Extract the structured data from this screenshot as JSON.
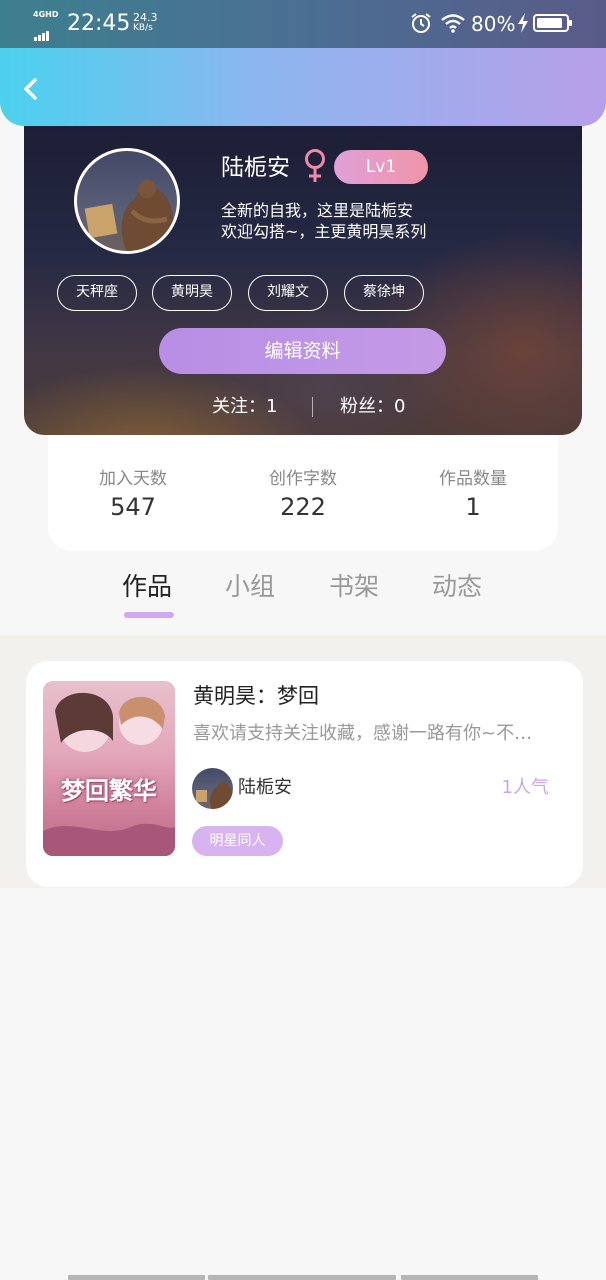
{
  "status_bar": {
    "network": "4GHD",
    "time": "22:45",
    "speed_value": "24.3",
    "speed_unit": "KB/s",
    "battery_percent": "80%",
    "icons": [
      "signal-icon",
      "alarm-icon",
      "wifi-icon",
      "charging-icon",
      "battery-icon"
    ]
  },
  "header": {
    "back_icon": "chevron-left-icon",
    "gradient": [
      "#4bd1ee",
      "#b79fe9"
    ]
  },
  "profile": {
    "username": "陆栀安",
    "gender_icon": "female-icon",
    "level": "Lv1",
    "bio_line1": "全新的自我，这里是陆栀安",
    "bio_line2": "欢迎勾搭~，主更黄明昊系列",
    "tags": [
      "天秤座",
      "黄明昊",
      "刘耀文",
      "蔡徐坤"
    ],
    "edit_button": "编辑资料",
    "following": "关注：1",
    "followers": "粉丝：0"
  },
  "stats": [
    {
      "label": "加入天数",
      "value": "547"
    },
    {
      "label": "创作字数",
      "value": "222"
    },
    {
      "label": "作品数量",
      "value": "1"
    }
  ],
  "tabs": [
    {
      "label": "作品",
      "active": true
    },
    {
      "label": "小组",
      "active": false
    },
    {
      "label": "书架",
      "active": false
    },
    {
      "label": "动态",
      "active": false
    }
  ],
  "works": [
    {
      "cover_title": "梦回繁华",
      "title": "黄明昊：梦回",
      "description": "喜欢请支持关注收藏，感谢一路有你~不…",
      "author": "陆栀安",
      "popularity": "1人气",
      "genre": "明星同人"
    }
  ],
  "colors": {
    "accent_purple": "#c49ae6",
    "level_pink": "#f095a8",
    "tab_underline": "#d1a8ec"
  }
}
